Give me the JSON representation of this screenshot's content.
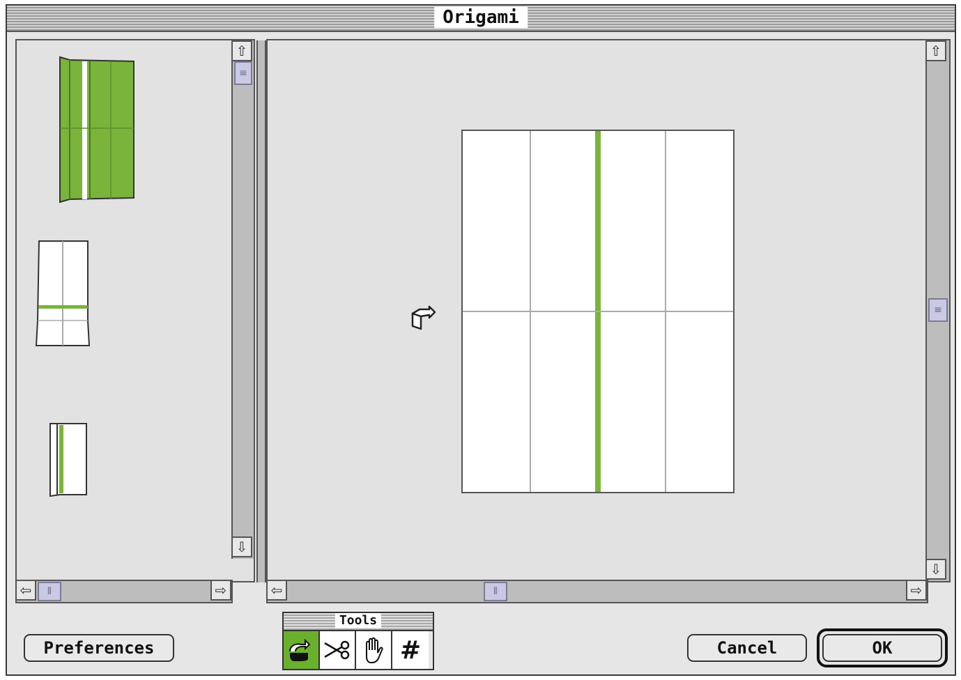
{
  "window": {
    "title": "Origami"
  },
  "buttons": {
    "preferences_label": "Preferences",
    "cancel_label": "Cancel",
    "ok_label": "OK"
  },
  "tools_palette": {
    "title": "Tools",
    "items": [
      {
        "icon": "fold-hand-icon",
        "selected": true
      },
      {
        "icon": "scissors-icon",
        "selected": false
      },
      {
        "icon": "grab-hand-icon",
        "selected": false
      },
      {
        "icon": "grid-icon",
        "selected": false
      }
    ]
  },
  "colors": {
    "accent_green": "#7ab43a",
    "selected_tool_green": "#6bb02c"
  },
  "main_view": {
    "paper": {
      "columns": 4,
      "rows": 2,
      "green_crease_after_column": 2
    },
    "cursor_icon": "rotate-cursor-icon"
  },
  "thumbnails": [
    {
      "step": 1,
      "color": "green"
    },
    {
      "step": 2,
      "color": "white"
    },
    {
      "step": 3,
      "color": "white"
    }
  ]
}
